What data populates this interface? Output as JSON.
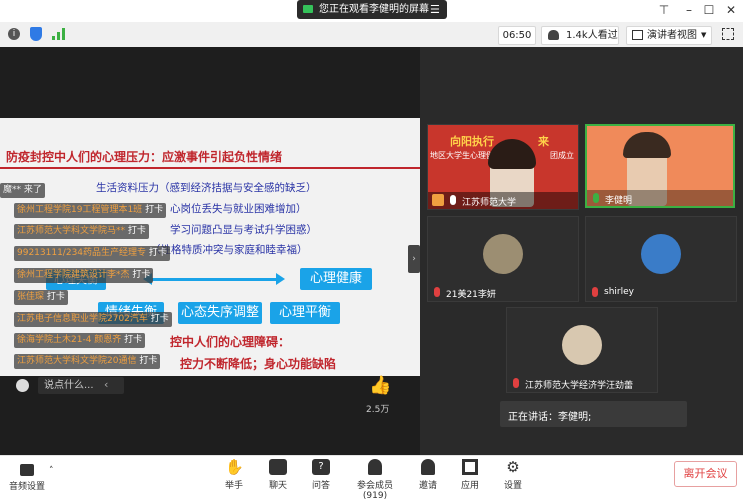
{
  "titlebar": {
    "share_notice": "您正在观看李健明的屏幕",
    "share_menu_icon": "menu-icon"
  },
  "toolbar": {
    "time": "06:50",
    "viewers": "1.4k人看过",
    "view_mode": "演讲者视图"
  },
  "slide": {
    "title": "防疫封控中人们的心理压力：应激事件引起负性情绪",
    "lines": [
      "生活资料压力（感到经济拮据与安全感的缺乏）",
      "心岗位丢失与就业困难增加）",
      "学习问题凸显与考试升学困惑）",
      "（性格特质冲突与家庭和睦幸福）"
    ],
    "box_health": "心理健康",
    "box_balance": "心理平衡",
    "box_adjust": "心态失序调整",
    "box_left_bottom": "情绪失衡",
    "box_left_top": "心理失衡",
    "bottom_line1": "控中人们的心理障碍：",
    "bottom_line2": "控力不断降低；身心功能缺陷"
  },
  "danmu": [
    {
      "text": "魔** 来了",
      "tag": ""
    },
    {
      "text": "徐州工程学院19工程管理本1班",
      "tag": "打卡"
    },
    {
      "text": "江苏师范大学科文学院马**",
      "tag": "打卡"
    },
    {
      "text": "99213111/234药品生产经理专",
      "tag": "打卡"
    },
    {
      "text": "徐州工程学院建筑设计李*杰",
      "tag": "打卡"
    },
    {
      "text": "张佳琛",
      "tag": "打卡"
    },
    {
      "text": "江苏电子信息职业学院2702汽车",
      "tag": "打卡"
    },
    {
      "text": "徐海学院土木21-4 颜恩齐",
      "tag": "打卡"
    },
    {
      "text": "江苏师范大学科文学院20通信",
      "tag": "打卡"
    }
  ],
  "comment": {
    "placeholder": "说点什么...",
    "likes": "2.5万"
  },
  "videos": [
    {
      "name": "江苏师范大学",
      "banner1": "向阳执行",
      "banner2": "地区大学生心理健康",
      "banner3": "来",
      "banner4": "团成立"
    },
    {
      "name": "李健明"
    },
    {
      "name": "21美21李妍"
    },
    {
      "name": "shirley"
    },
    {
      "name": "江苏师范大学经济学汪劲蕾"
    }
  ],
  "speaking": "正在讲话：李健明;",
  "bottom": {
    "audio": "音频设置",
    "raise": "举手",
    "chat": "聊天",
    "qa": "问答",
    "members": "参会成员(919)",
    "invite": "邀请",
    "apps": "应用",
    "settings": "设置",
    "leave": "离开会议"
  },
  "colors": {
    "accent": "#1aa3e8",
    "leave": "#e04040",
    "title_red": "#c0262d",
    "slide_blue": "#2a34a6"
  }
}
